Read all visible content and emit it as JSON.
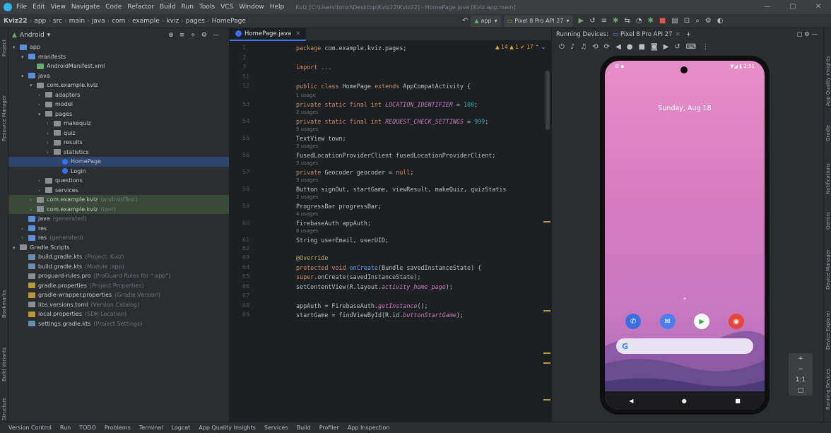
{
  "title_bar": {
    "menus": [
      "File",
      "Edit",
      "View",
      "Navigate",
      "Code",
      "Refactor",
      "Build",
      "Run",
      "Tools",
      "VCS",
      "Window",
      "Help"
    ],
    "window_title": "Kviz [C:\\Users\\tonxi\\Desktop\\Kviz22\\Kviz22] - HomePage.java [Kviz.app.main]"
  },
  "nav_bar": {
    "breadcrumbs": [
      "Kviz22",
      "app",
      "src",
      "main",
      "java",
      "com",
      "example",
      "kviz",
      "pages",
      "HomePage"
    ],
    "run_config": "app",
    "device": "Pixel 8 Pro API 27"
  },
  "project_panel": {
    "view_mode": "Android",
    "tree": [
      {
        "label": "app",
        "depth": 0,
        "arrow": "v",
        "color": "#5b8fd9",
        "bold": true
      },
      {
        "label": "manifests",
        "depth": 1,
        "arrow": "v",
        "color": "#5b8fd9"
      },
      {
        "label": "AndroidManifest.xml",
        "depth": 2,
        "arrow": "",
        "color": "#6aab73"
      },
      {
        "label": "java",
        "depth": 1,
        "arrow": "v",
        "color": "#5b8fd9"
      },
      {
        "label": "com.example.kviz",
        "depth": 2,
        "arrow": "v",
        "color": "#8c8f94"
      },
      {
        "label": "adapters",
        "depth": 3,
        "arrow": ">",
        "color": "#8c8f94"
      },
      {
        "label": "model",
        "depth": 3,
        "arrow": ">",
        "color": "#8c8f94"
      },
      {
        "label": "pages",
        "depth": 3,
        "arrow": "v",
        "color": "#8c8f94"
      },
      {
        "label": "makequiz",
        "depth": 4,
        "arrow": ">",
        "color": "#8c8f94"
      },
      {
        "label": "quiz",
        "depth": 4,
        "arrow": ">",
        "color": "#8c8f94"
      },
      {
        "label": "results",
        "depth": 4,
        "arrow": ">",
        "color": "#8c8f94"
      },
      {
        "label": "statistics",
        "depth": 4,
        "arrow": ">",
        "color": "#8c8f94"
      },
      {
        "label": "HomePage",
        "depth": 5,
        "arrow": "",
        "color": "#3574f0",
        "selected": true,
        "circle": true
      },
      {
        "label": "Login",
        "depth": 5,
        "arrow": "",
        "color": "#3574f0",
        "circle": true
      },
      {
        "label": "questions",
        "depth": 3,
        "arrow": ">",
        "color": "#8c8f94"
      },
      {
        "label": "services",
        "depth": 3,
        "arrow": ">",
        "color": "#8c8f94"
      },
      {
        "label": "com.example.kviz",
        "suffix": "(androidTest)",
        "depth": 2,
        "arrow": ">",
        "color": "#8c8f94",
        "hl": true
      },
      {
        "label": "com.example.kviz",
        "suffix": "(test)",
        "depth": 2,
        "arrow": ">",
        "color": "#8c8f94",
        "hl": true
      },
      {
        "label": "java",
        "suffix": "(generated)",
        "depth": 1,
        "arrow": "",
        "color": "#5b8fd9"
      },
      {
        "label": "res",
        "depth": 1,
        "arrow": ">",
        "color": "#5b8fd9"
      },
      {
        "label": "res",
        "suffix": "(generated)",
        "depth": 1,
        "arrow": ">",
        "color": "#5b8fd9"
      },
      {
        "label": "Gradle Scripts",
        "depth": 0,
        "arrow": "v",
        "color": "#8c8f94"
      },
      {
        "label": "build.gradle.kts",
        "suffix": "(Project: Kviz)",
        "depth": 1,
        "arrow": "",
        "color": "#6a8caf"
      },
      {
        "label": "build.gradle.kts",
        "suffix": "(Module :app)",
        "depth": 1,
        "arrow": "",
        "color": "#6a8caf"
      },
      {
        "label": "proguard-rules.pro",
        "suffix": "(ProGuard Rules for \":app\")",
        "depth": 1,
        "arrow": "",
        "color": "#8c8f94"
      },
      {
        "label": "gradle.properties",
        "suffix": "(Project Properties)",
        "depth": 1,
        "arrow": "",
        "color": "#b59a3c"
      },
      {
        "label": "gradle-wrapper.properties",
        "suffix": "(Gradle Version)",
        "depth": 1,
        "arrow": "",
        "color": "#b59a3c"
      },
      {
        "label": "libs.versions.toml",
        "suffix": "(Version Catalog)",
        "depth": 1,
        "arrow": "",
        "color": "#8c8f94"
      },
      {
        "label": "local.properties",
        "suffix": "(SDK Location)",
        "depth": 1,
        "arrow": "",
        "color": "#b59a3c"
      },
      {
        "label": "settings.gradle.kts",
        "suffix": "(Project Settings)",
        "depth": 1,
        "arrow": "",
        "color": "#6a8caf"
      }
    ]
  },
  "editor": {
    "tab": "HomePage.java",
    "inspections": "▲ 14  ▲ 1  ✔ 17",
    "lines": [
      {
        "n": "1",
        "hint": "",
        "parts": [
          [
            "kw",
            "package "
          ],
          [
            "var",
            "com.example.kviz.pages;"
          ]
        ]
      },
      {
        "n": "2",
        "hint": "",
        "parts": []
      },
      {
        "n": "3",
        "hint": "",
        "parts": [
          [
            "kw",
            "import "
          ],
          [
            "str",
            "..."
          ]
        ]
      },
      {
        "n": "51",
        "hint": "",
        "parts": []
      },
      {
        "n": "52",
        "hint": "",
        "parts": [
          [
            "kw",
            "public class "
          ],
          [
            "typ",
            "HomePage "
          ],
          [
            "kw",
            "extends "
          ],
          [
            "typ",
            "AppCompatActivity {"
          ]
        ]
      },
      {
        "n": "53",
        "hint": "1 usage",
        "parts": [
          [
            "kw",
            "private static final int "
          ],
          [
            "fld",
            "LOCATION_IDENTIFIER"
          ],
          [
            "var",
            " = "
          ],
          [
            "num",
            "100"
          ],
          [
            "var",
            ";"
          ]
        ]
      },
      {
        "n": "54",
        "hint": "2 usages",
        "parts": [
          [
            "kw",
            "private static final int "
          ],
          [
            "fld",
            "REQUEST_CHECK_SETTINGS"
          ],
          [
            "var",
            " = "
          ],
          [
            "num",
            "999"
          ],
          [
            "var",
            ";"
          ]
        ]
      },
      {
        "n": "55",
        "hint": "5 usages",
        "parts": [
          [
            "typ",
            "TextView "
          ],
          [
            "var",
            "town;"
          ]
        ]
      },
      {
        "n": "56",
        "hint": "3 usages",
        "parts": [
          [
            "typ",
            "FusedLocationProviderClient "
          ],
          [
            "var",
            "fusedLocationProviderClient;"
          ]
        ]
      },
      {
        "n": "57",
        "hint": "3 usages",
        "parts": [
          [
            "kw",
            "private "
          ],
          [
            "typ",
            "Geocoder "
          ],
          [
            "var",
            "geocoder = "
          ],
          [
            "kw",
            "null"
          ],
          [
            "var",
            ";"
          ]
        ]
      },
      {
        "n": "58",
        "hint": "3 usages",
        "parts": [
          [
            "typ",
            "Button "
          ],
          [
            "var",
            "signOut, startGame, viewResult, makeQuiz, quizStatis"
          ]
        ]
      },
      {
        "n": "59",
        "hint": "2 usages",
        "parts": [
          [
            "typ",
            "ProgressBar "
          ],
          [
            "var",
            "progressBar;"
          ]
        ]
      },
      {
        "n": "60",
        "hint": "4 usages",
        "parts": [
          [
            "typ",
            "FirebaseAuth "
          ],
          [
            "var",
            "appAuth;"
          ]
        ]
      },
      {
        "n": "61",
        "hint": "8 usages",
        "parts": [
          [
            "typ",
            "String "
          ],
          [
            "var",
            "userEmail, userUID;"
          ]
        ]
      },
      {
        "n": "62",
        "hint": "",
        "parts": []
      },
      {
        "n": "63",
        "hint": "",
        "parts": [
          [
            "ann",
            "@Override"
          ]
        ]
      },
      {
        "n": "64",
        "hint": "",
        "parts": [
          [
            "kw",
            "protected void "
          ],
          [
            "fn",
            "onCreate"
          ],
          [
            "var",
            "(Bundle savedInstanceState) {"
          ]
        ]
      },
      {
        "n": "65",
        "hint": "",
        "parts": [
          [
            "kw",
            "    super"
          ],
          [
            "var",
            ".onCreate(savedInstanceState);"
          ]
        ]
      },
      {
        "n": "66",
        "hint": "",
        "parts": [
          [
            "var",
            "    setContentView(R.layout."
          ],
          [
            "fld",
            "activity_home_page"
          ],
          [
            "var",
            ");"
          ]
        ]
      },
      {
        "n": "67",
        "hint": "",
        "parts": []
      },
      {
        "n": "68",
        "hint": "",
        "parts": [
          [
            "var",
            "    appAuth = FirebaseAuth."
          ],
          [
            "fld",
            "getInstance"
          ],
          [
            "var",
            "();"
          ]
        ]
      },
      {
        "n": "69",
        "hint": "",
        "parts": [
          [
            "var",
            "    startGame = findViewById(R.id."
          ],
          [
            "fld",
            "buttonStartGame"
          ],
          [
            "var",
            ");"
          ]
        ]
      }
    ]
  },
  "device_panel": {
    "title": "Running Devices:",
    "device_tab": "Pixel 8 Pro API 27",
    "phone": {
      "time": "2:51",
      "date": "Sunday, Aug 18",
      "search_g": "G",
      "apps": [
        {
          "name": "phone-app-icon",
          "color": "#3b6ee0",
          "glyph": "✆"
        },
        {
          "name": "messages-app-icon",
          "color": "#4a7ef0",
          "glyph": "✉"
        },
        {
          "name": "play-store-icon",
          "color": "#ffffff",
          "glyph": "▶"
        },
        {
          "name": "chrome-icon",
          "color": "#e8453c",
          "glyph": "◉"
        }
      ]
    },
    "emu_controls": [
      "+",
      "−",
      "1:1",
      "□"
    ]
  },
  "left_strip": [
    "Project",
    "Resource Manager",
    "Bookmarks",
    "Build Variants",
    "Structure"
  ],
  "right_strip": [
    "App Quality Insights",
    "Gradle",
    "Notifications",
    "Gemini",
    "Device Manager",
    "Device Explorer",
    "Running Devices"
  ],
  "status_bar": [
    "Version Control",
    "Run",
    "TODO",
    "Problems",
    "Terminal",
    "Logcat",
    "App Quality Insights",
    "Services",
    "Build",
    "Profiler",
    "App Inspection"
  ]
}
